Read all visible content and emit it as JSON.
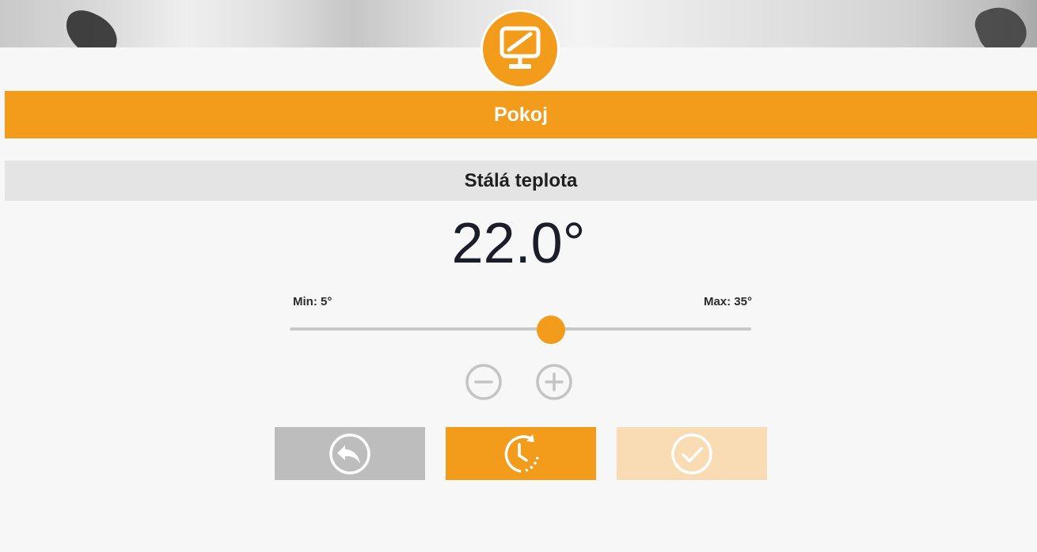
{
  "colors": {
    "accent": "#f39c1c",
    "accent_light": "#f9dcb3",
    "neutral_button": "#bdbdbd",
    "mode_bar": "#e4e4e4",
    "background": "#f7f7f7"
  },
  "header": {
    "icon": "monitor-icon",
    "title": "Pokoj"
  },
  "mode": {
    "label": "Stálá teplota"
  },
  "temperature": {
    "value": "22.0°",
    "min_label": "Min: 5°",
    "max_label": "Max: 35°",
    "slider": {
      "min": 5,
      "max": 35,
      "value": 22.0
    }
  },
  "stepper": {
    "decrease_icon": "minus-circle-icon",
    "increase_icon": "plus-circle-icon"
  },
  "actions": [
    {
      "name": "back",
      "icon": "undo-arrow-icon"
    },
    {
      "name": "schedule",
      "icon": "clock-schedule-icon"
    },
    {
      "name": "confirm",
      "icon": "check-circle-icon"
    }
  ]
}
